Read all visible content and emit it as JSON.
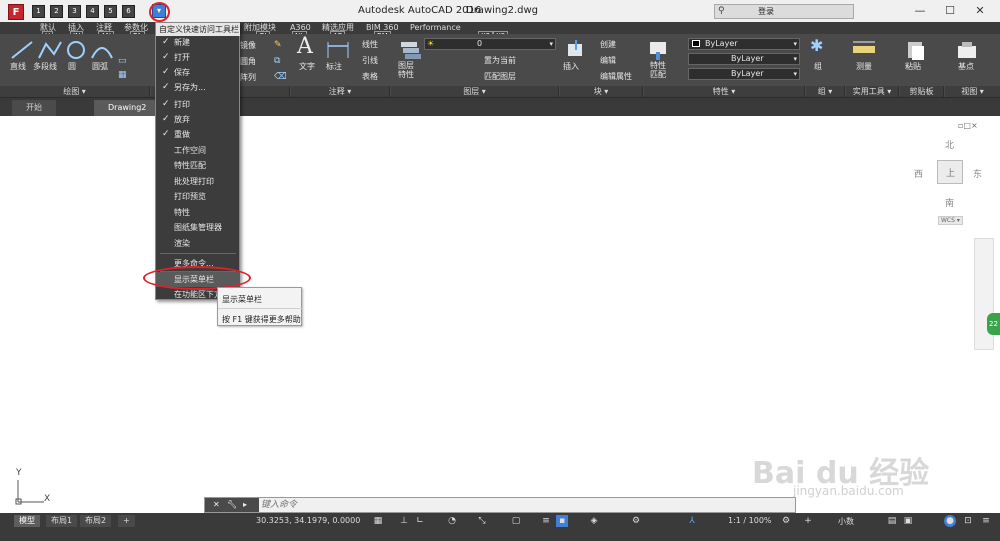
{
  "titlebar": {
    "app_icon": "F",
    "title": "Autodesk AutoCAD 2016",
    "file": "Drawing2.dwg",
    "login": "登录",
    "qat_buttons": [
      "1",
      "2",
      "3",
      "4",
      "5",
      "6"
    ],
    "qat_dropdown_icon": "chevron-down-icon",
    "controls": [
      "—",
      "☐",
      "✕"
    ]
  },
  "keytips": [
    "H",
    "IN",
    "AN",
    "PA",
    "GI",
    "NL",
    "AP",
    "BM",
    "X2",
    "X3"
  ],
  "ribbon_tabs": [
    "默认",
    "插入",
    "注释",
    "参数化",
    "附加模块",
    "A360",
    "精选应用",
    "BIM 360",
    "Performance"
  ],
  "ribbon": {
    "draw": {
      "line": "直线",
      "polyline": "多段线",
      "circle": "圆",
      "arc": "圆弧",
      "title": "绘图 ▾"
    },
    "modify": {
      "rotate_label": "镜像",
      "fillet": "圆角",
      "array": "阵列"
    },
    "annotation": {
      "text": "文字",
      "dim": "标注",
      "linear": "线性",
      "leader": "引线",
      "table": "表格",
      "title": "注释 ▾"
    },
    "layers": {
      "props": "图层\n特性",
      "set_current": "置为当前",
      "match": "匹配图层",
      "layer_value": "0",
      "title": "图层 ▾"
    },
    "block": {
      "insert": "插入",
      "create": "创建",
      "edit": "编辑",
      "edit_attr": "编辑属性",
      "title": "块 ▾"
    },
    "properties": {
      "match": "特性\n匹配",
      "bylayer1": "ByLayer",
      "bylayer2": "ByLayer",
      "bylayer3": "ByLayer",
      "title": "特性 ▾"
    },
    "groups": {
      "group": "组",
      "title": "组 ▾"
    },
    "utilities": {
      "measure": "测量",
      "title": "实用工具 ▾"
    },
    "clipboard": {
      "paste": "粘贴",
      "title": "剪贴板"
    },
    "view": {
      "base": "基点",
      "title": "视图 ▾"
    }
  },
  "qat_menu": {
    "title": "自定义快速访问工具栏",
    "checked_items": [
      "新建",
      "打开",
      "保存",
      "另存为...",
      "打印",
      "放弃",
      "重做"
    ],
    "unchecked_items": [
      "工作空间",
      "特性匹配",
      "批处理打印",
      "打印预览",
      "特性",
      "图纸集管理器",
      "渲染"
    ],
    "more": "更多命令...",
    "show_menubar": "显示菜单栏",
    "below_ribbon": "在功能区下方显示"
  },
  "tooltip": {
    "line1": "显示菜单栏",
    "line2": "按 F1 键获得更多帮助"
  },
  "doc_tabs": [
    "开始",
    "Drawing2"
  ],
  "viewcube": {
    "north": "北",
    "south": "南",
    "east": "东",
    "west": "西",
    "wcs": "WCS ▾",
    "top": "上"
  },
  "ucs": {
    "y": "Y",
    "x": "X"
  },
  "cmdline": {
    "placeholder": "键入命令"
  },
  "layout_tabs": [
    "模型",
    "布局1",
    "布局2",
    "+"
  ],
  "status": {
    "coords": "30.3253, 34.1979, 0.0000",
    "model_icon": "grid-icon",
    "scale": "1:1 / 100%",
    "units": "小数"
  },
  "watermark": {
    "brand": "Bai du 经验",
    "url": "jingyan.baidu.com"
  },
  "green_badge": "22",
  "colors": {
    "ribbon": "#4a4a4a",
    "highlight_circle": "#e0202a",
    "dropdown_button": "#3f7fd5"
  }
}
